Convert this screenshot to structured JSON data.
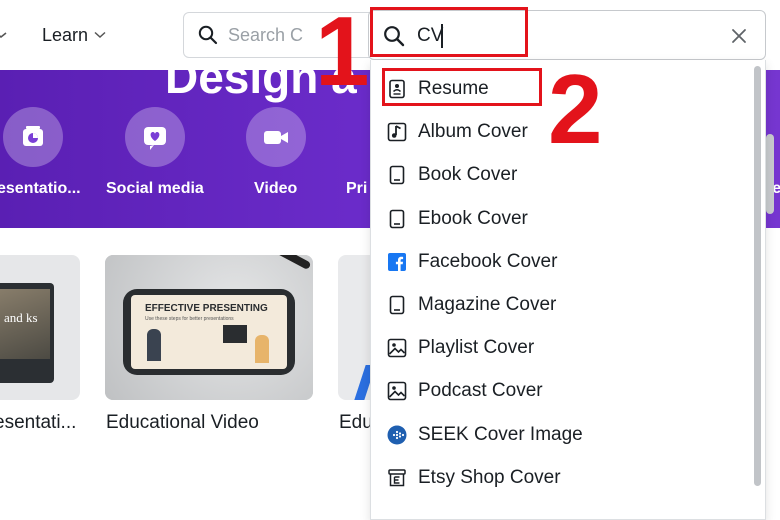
{
  "topbar": {
    "learn_label": "Learn",
    "search_placeholder": "Search C"
  },
  "hero": {
    "title": "Design a",
    "categories": [
      {
        "label": "esentatio...",
        "icon": "presentation-icon"
      },
      {
        "label": "Social media",
        "icon": "heart-icon"
      },
      {
        "label": "Video",
        "icon": "video-camera-icon"
      },
      {
        "label": "Pri",
        "icon": "print-icon"
      },
      {
        "label": "re",
        "icon": "more-icon"
      }
    ]
  },
  "cards": [
    {
      "title": "esentati...",
      "thumb_text": "and ks"
    },
    {
      "title": "Educational Video",
      "thumb_text": "EFFECTIVE PRESENTING",
      "thumb_subtext": "Use these steps for better presentations"
    },
    {
      "title": "Edu"
    }
  ],
  "search": {
    "value": "CV"
  },
  "dropdown": {
    "items": [
      {
        "label": "Resume",
        "icon": "resume-icon"
      },
      {
        "label": "Album Cover",
        "icon": "music-note-icon"
      },
      {
        "label": "Book Cover",
        "icon": "book-icon"
      },
      {
        "label": "Ebook Cover",
        "icon": "ebook-icon"
      },
      {
        "label": "Facebook Cover",
        "icon": "facebook-icon"
      },
      {
        "label": "Magazine Cover",
        "icon": "magazine-icon"
      },
      {
        "label": "Playlist Cover",
        "icon": "image-icon"
      },
      {
        "label": "Podcast Cover",
        "icon": "image-icon"
      },
      {
        "label": "SEEK Cover Image",
        "icon": "seek-icon"
      },
      {
        "label": "Etsy Shop Cover",
        "icon": "etsy-shop-icon"
      }
    ]
  },
  "annotations": {
    "step1": "1",
    "step2": "2",
    "color": "#e3131b"
  },
  "colors": {
    "hero_purple": "#6a2bc9",
    "facebook_blue": "#1877f2",
    "seek_blue": "#1f5fb0"
  }
}
